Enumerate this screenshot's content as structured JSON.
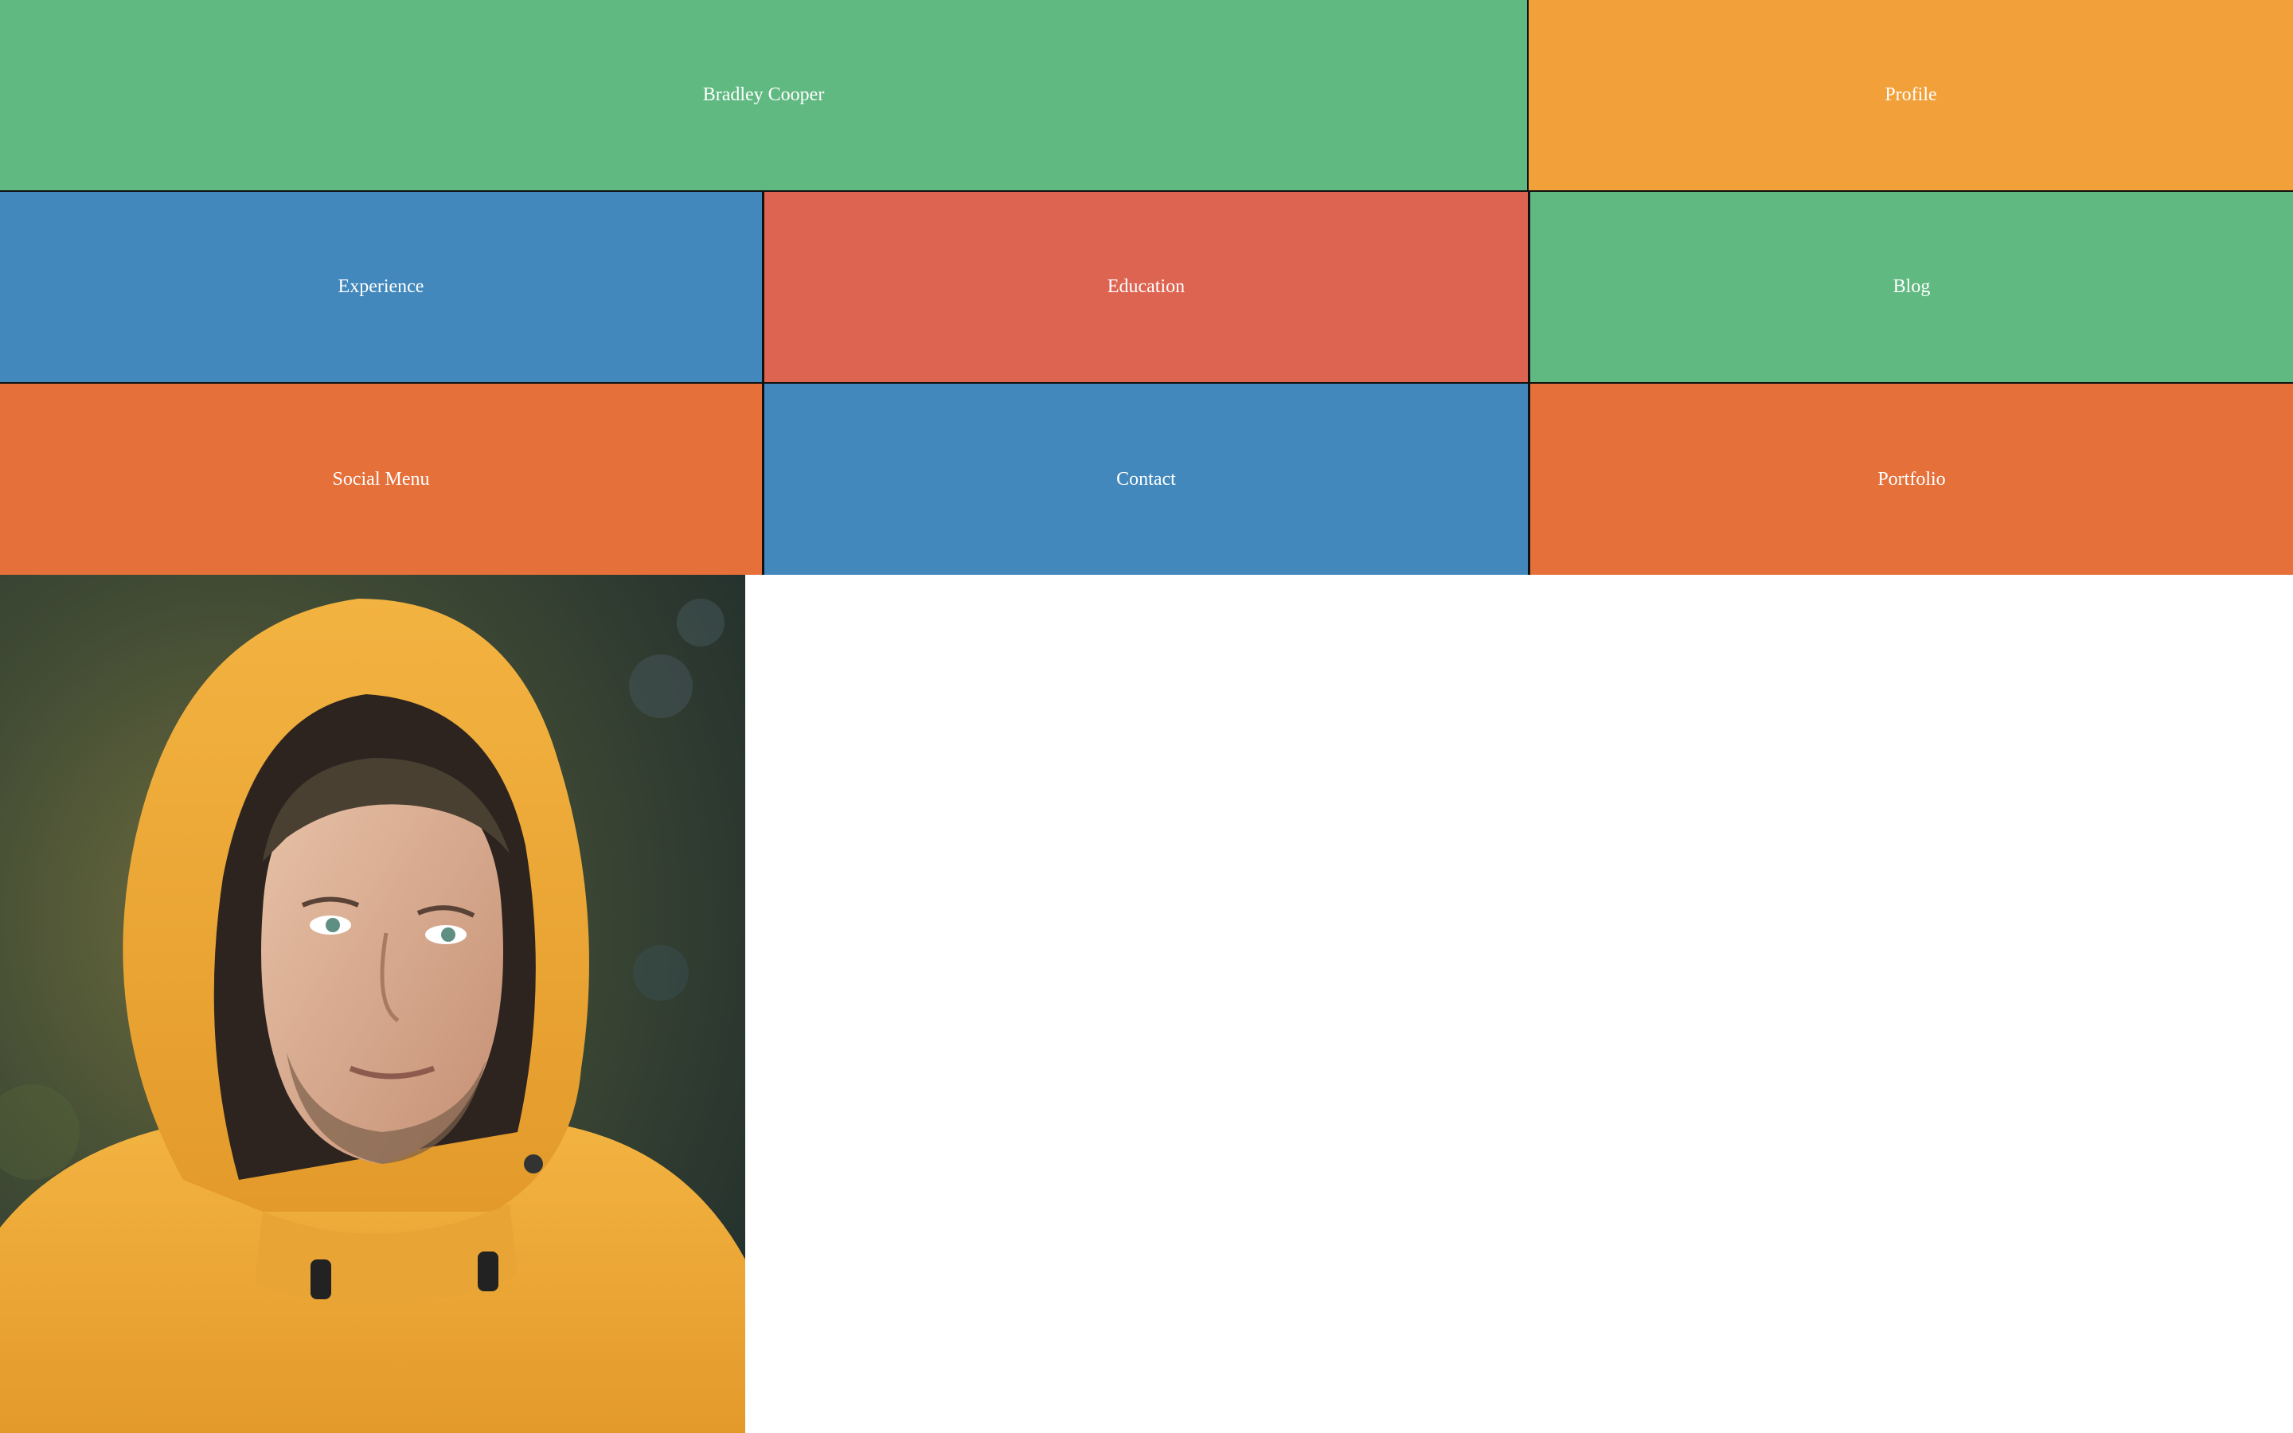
{
  "nav": {
    "name": {
      "label": "Bradley Cooper",
      "color": "#60B981"
    },
    "profile": {
      "label": "Profile",
      "color": "#F2A13A"
    },
    "experience": {
      "label": "Experience",
      "color": "#4288BC"
    },
    "education": {
      "label": "Education",
      "color": "#DE6452"
    },
    "blog": {
      "label": "Blog",
      "color": "#60B981"
    },
    "social": {
      "label": "Social Menu",
      "color": "#E6703A"
    },
    "contact": {
      "label": "Contact",
      "color": "#4288BC"
    },
    "portfolio": {
      "label": "Portfolio",
      "color": "#E6703A"
    }
  },
  "photo": {
    "subject": "man in orange hooded raincoat",
    "accent_color": "#F0A83C"
  }
}
